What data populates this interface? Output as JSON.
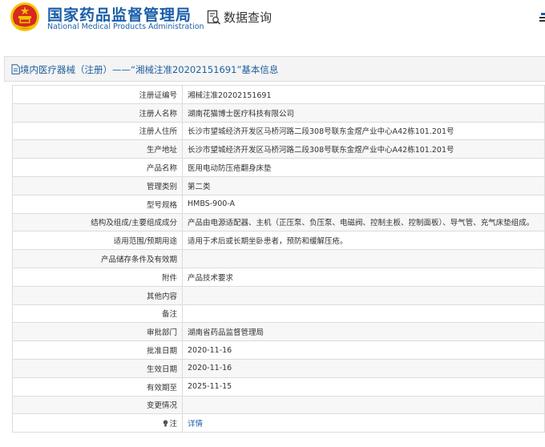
{
  "header": {
    "logo_title": "国家药品监督管理局",
    "logo_subtitle": "National Medical Products Administration",
    "query_label": "数据查询",
    "emblem_icon": "national-emblem-icon",
    "query_icon": "document-search-icon"
  },
  "title_bar": {
    "text": "境内医疗器械（注册）——“湘械注准20202151691”基本信息",
    "icon": "document-icon"
  },
  "rows": [
    {
      "label": "注册证编号",
      "value": "湘械注准20202151691"
    },
    {
      "label": "注册人名称",
      "value": "湖南花猫博士医疗科技有限公司"
    },
    {
      "label": "注册人住所",
      "value": "长沙市望城经济开发区马桥河路二段308号联东金煜产业中心A42栋101.201号"
    },
    {
      "label": "生产地址",
      "value": "长沙市望城经济开发区马桥河路二段308号联东金煜产业中心A42栋101.201号"
    },
    {
      "label": "产品名称",
      "value": "医用电动防压疮翻身床垫"
    },
    {
      "label": "管理类别",
      "value": "第二类"
    },
    {
      "label": "型号规格",
      "value": "HMBS-900-A"
    },
    {
      "label": "结构及组成/主要组成成分",
      "value": "产品由电源适配器、主机（正压泵、负压泵、电磁阀、控制主板、控制面板）、导气管、充气床垫组成。"
    },
    {
      "label": "适用范围/预期用途",
      "value": "适用于术后或长期坐卧患者，预防和缓解压疮。"
    },
    {
      "label": "产品储存条件及有效期",
      "value": ""
    },
    {
      "label": "附件",
      "value": "产品技术要求"
    },
    {
      "label": "其他内容",
      "value": ""
    },
    {
      "label": "备注",
      "value": ""
    },
    {
      "label": "审批部门",
      "value": "湖南省药品监督管理局"
    },
    {
      "label": "批准日期",
      "value": "2020-11-16"
    },
    {
      "label": "生效日期",
      "value": "2020-11-16"
    },
    {
      "label": "有效期至",
      "value": "2025-11-15"
    },
    {
      "label": "变更情况",
      "value": ""
    }
  ],
  "note_row": {
    "label": "注",
    "value": "详情",
    "icon": "lightbulb-icon"
  },
  "colors": {
    "brand_blue": "#1a5ea8",
    "emblem_red": "#d52b1e",
    "emblem_gold": "#f4c400"
  }
}
